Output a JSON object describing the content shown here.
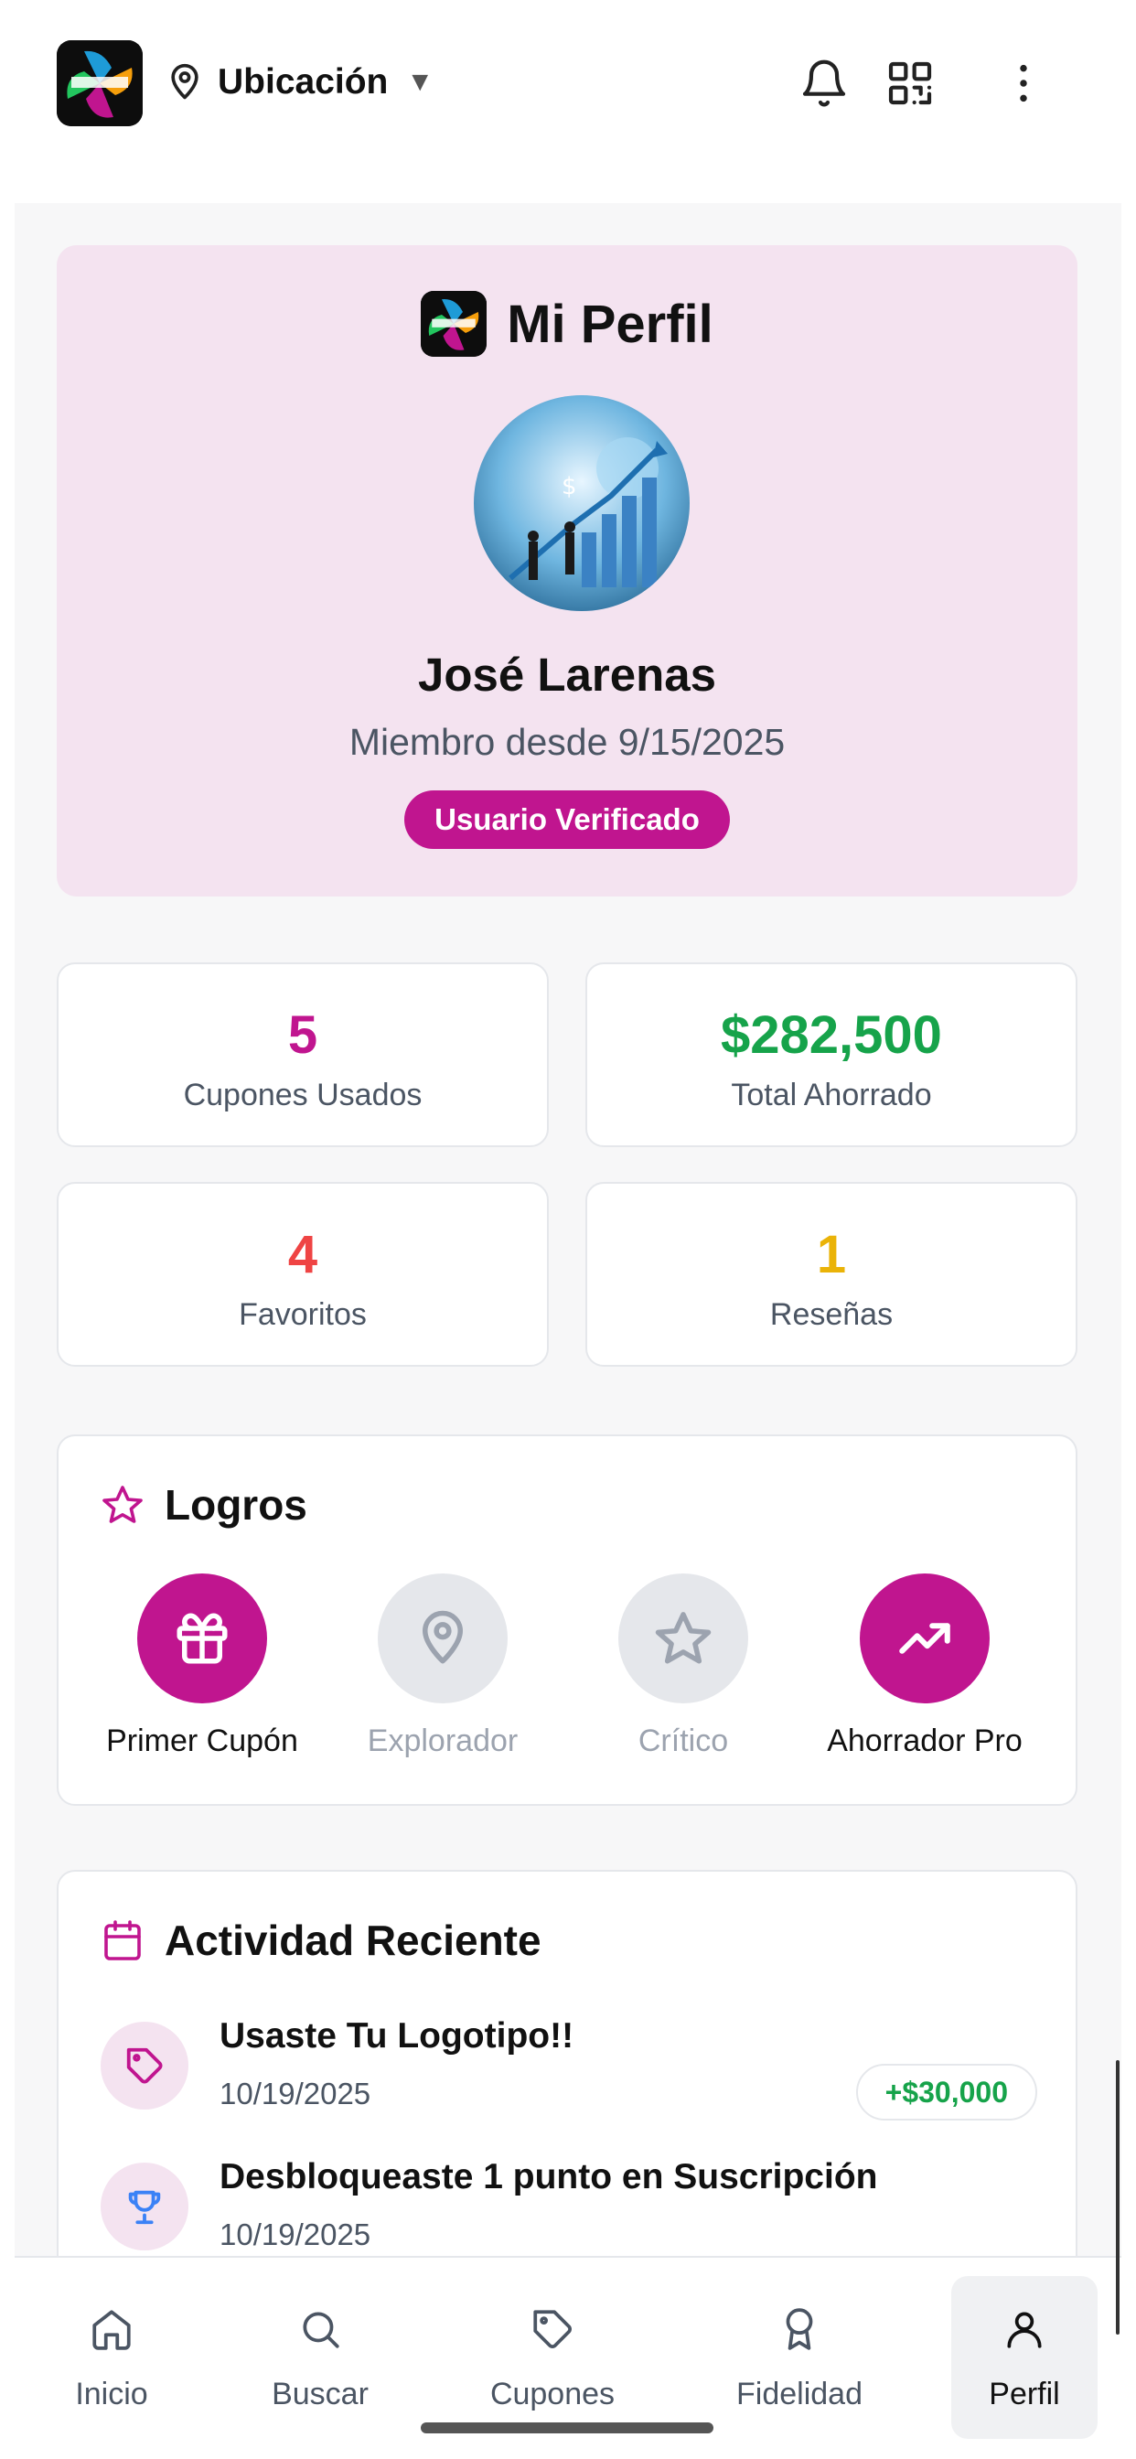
{
  "header": {
    "location_label": "Ubicación",
    "caret": "▼",
    "icons": [
      "map-pin-icon",
      "bell-icon",
      "qr-code-icon",
      "more-vertical-icon"
    ]
  },
  "profile": {
    "title": "Mi Perfil",
    "name": "José Larenas",
    "member_since": "Miembro desde 9/15/2025",
    "badge": "Usuario Verificado"
  },
  "stats": [
    {
      "value": "5",
      "label": "Cupones Usados",
      "color": "#c0158f"
    },
    {
      "value": "$282,500",
      "label": "Total Ahorrado",
      "color": "#16a34a"
    },
    {
      "value": "4",
      "label": "Favoritos",
      "color": "#ef4444"
    },
    {
      "value": "1",
      "label": "Reseñas",
      "color": "#eab308"
    }
  ],
  "achievements": {
    "title": "Logros",
    "items": [
      {
        "label": "Primer Cupón",
        "icon": "gift-icon",
        "unlocked": true
      },
      {
        "label": "Explorador",
        "icon": "map-pin-icon",
        "unlocked": false
      },
      {
        "label": "Crítico",
        "icon": "star-icon",
        "unlocked": false
      },
      {
        "label": "Ahorrador Pro",
        "icon": "trending-up-icon",
        "unlocked": true
      }
    ]
  },
  "activity": {
    "title": "Actividad Reciente",
    "items": [
      {
        "title": "Usaste Tu Logotipo!!",
        "date": "10/19/2025",
        "amount": "+$30,000",
        "icon": "tag-icon"
      },
      {
        "title": "Desbloqueaste 1 punto en Suscripción",
        "date": "10/19/2025",
        "amount": "",
        "icon": "trophy-icon"
      }
    ]
  },
  "nav": [
    {
      "label": "Inicio",
      "icon": "home-icon",
      "active": false
    },
    {
      "label": "Buscar",
      "icon": "search-icon",
      "active": false
    },
    {
      "label": "Cupones",
      "icon": "tag-icon",
      "active": false
    },
    {
      "label": "Fidelidad",
      "icon": "award-icon",
      "active": false
    },
    {
      "label": "Perfil",
      "icon": "user-icon",
      "active": true
    }
  ],
  "colors": {
    "brand": "#c0158f",
    "brand_light": "#f4e3f0",
    "success": "#16a34a",
    "danger": "#ef4444",
    "warning": "#eab308",
    "muted": "#4b5563"
  }
}
